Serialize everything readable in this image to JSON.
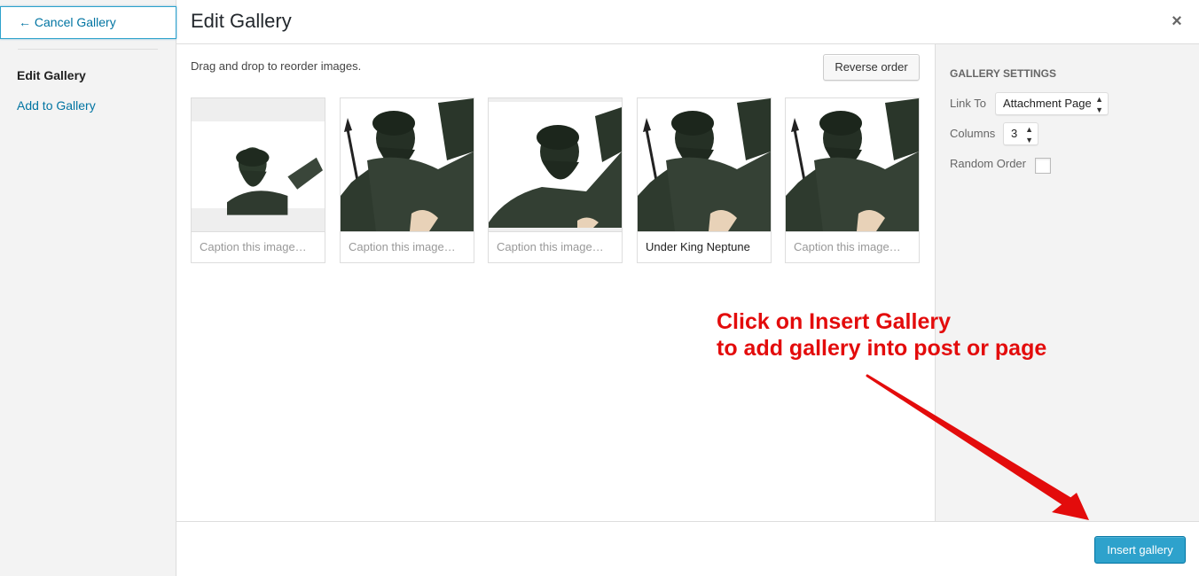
{
  "menu": {
    "cancel_label": "← Cancel Gallery",
    "current_label": "Edit Gallery",
    "add_label": "Add to Gallery"
  },
  "header": {
    "title": "Edit Gallery",
    "close_symbol": "×"
  },
  "content": {
    "instructions": "Drag and drop to reorder images.",
    "reverse_label": "Reverse order",
    "images": [
      {
        "caption_placeholder": "Caption this image…",
        "caption_value": ""
      },
      {
        "caption_placeholder": "Caption this image…",
        "caption_value": ""
      },
      {
        "caption_placeholder": "Caption this image…",
        "caption_value": ""
      },
      {
        "caption_placeholder": "Caption this image…",
        "caption_value": "Under King Neptune"
      },
      {
        "caption_placeholder": "Caption this image…",
        "caption_value": ""
      }
    ]
  },
  "settings": {
    "heading": "GALLERY SETTINGS",
    "link_to_label": "Link To",
    "link_to_value": "Attachment Page",
    "columns_label": "Columns",
    "columns_value": "3",
    "random_label": "Random Order"
  },
  "toolbar": {
    "insert_label": "Insert gallery"
  },
  "annotation": {
    "line1": "Click on Insert Gallery",
    "line2": "to add gallery into post or page"
  },
  "colors": {
    "accent": "#2ea2cc",
    "link": "#0074a2",
    "annotation": "#e30c0c"
  }
}
